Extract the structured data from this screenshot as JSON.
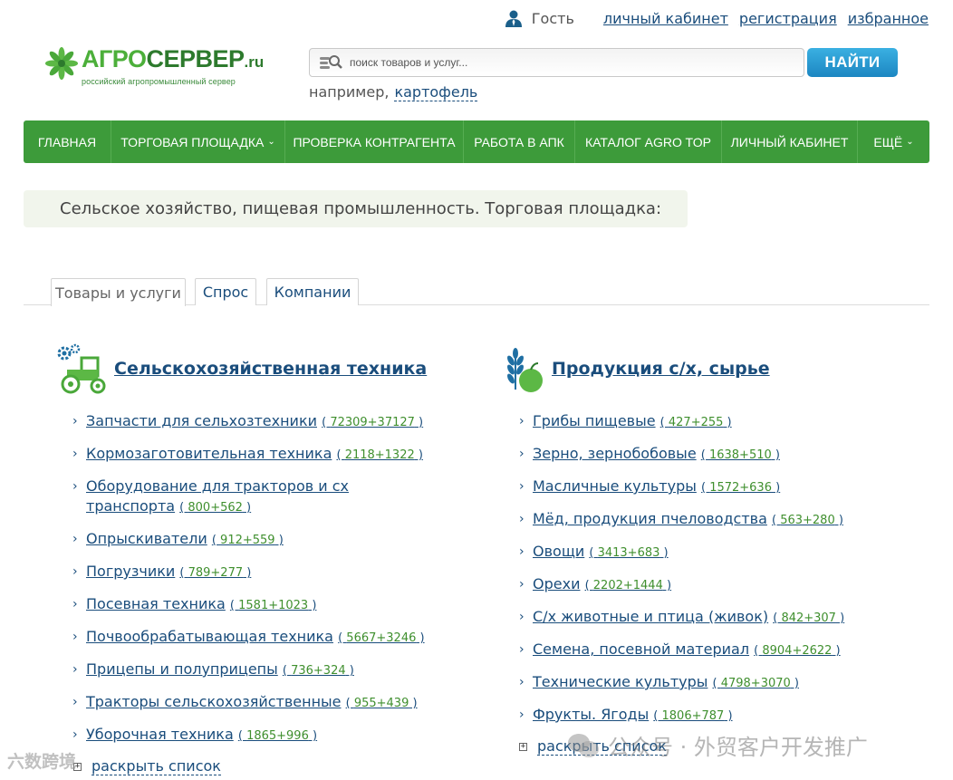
{
  "topbar": {
    "guest_label": "Гость",
    "links": [
      "личный кабинет",
      "регистрация",
      "избранное"
    ]
  },
  "logo": {
    "name_part1": "АГРО",
    "name_part2": "СЕРВЕР",
    "name_suffix": ".ru",
    "tagline": "российский агропромышленный сервер"
  },
  "search": {
    "placeholder": "поиск товаров и услуг...",
    "button_label": "НАЙТИ",
    "example_prefix": "например,",
    "example_link": "картофель"
  },
  "nav": {
    "items": [
      {
        "label": "ГЛАВНАЯ",
        "caret": ""
      },
      {
        "label": "ТОРГОВАЯ ПЛОЩАДКА",
        "caret": "⌄"
      },
      {
        "label": "ПРОВЕРКА КОНТРАГЕНТА",
        "caret": ""
      },
      {
        "label": "РАБОТА В АПК",
        "caret": ""
      },
      {
        "label": "КАТАЛОГ AGRO TOP",
        "caret": ""
      },
      {
        "label": "ЛИЧНЫЙ КАБИНЕТ",
        "caret": ""
      },
      {
        "label": "ЕЩЁ",
        "caret": "⌄"
      }
    ]
  },
  "page": {
    "heading": "Сельское хозяйство, пищевая промышленность. Торговая площадка:"
  },
  "tabs": [
    "Товары и услуги",
    "Спрос",
    "Компании"
  ],
  "categories": [
    {
      "title": "Сельскохозяйственная техника",
      "icon": "tractor-icon",
      "items": [
        {
          "label": "Запчасти для сельхозтехники",
          "count": "72309+37127"
        },
        {
          "label": "Кормозаготовительная техника",
          "count": "2118+1322"
        },
        {
          "label": "Оборудование для тракторов и сх",
          "label2": "транспорта",
          "count": "800+562"
        },
        {
          "label": "Опрыскиватели",
          "count": "912+559"
        },
        {
          "label": "Погрузчики",
          "count": "789+277"
        },
        {
          "label": "Посевная техника",
          "count": "1581+1023"
        },
        {
          "label": "Почвообрабатывающая техника",
          "count": "5667+3246"
        },
        {
          "label": "Прицепы и полуприцепы",
          "count": "736+324"
        },
        {
          "label": "Тракторы сельскохозяйственные",
          "count": "955+439"
        },
        {
          "label": "Уборочная техника",
          "count": "1865+996"
        }
      ],
      "expand_label": "раскрыть список"
    },
    {
      "title": "Продукция с/х, сырье",
      "icon": "wheat-apple-icon",
      "items": [
        {
          "label": "Грибы пищевые",
          "count": "427+255"
        },
        {
          "label": "Зерно, зернобобовые",
          "count": "1638+510"
        },
        {
          "label": "Масличные культуры",
          "count": "1572+636"
        },
        {
          "label": "Мёд, продукция пчеловодства",
          "count": "563+280"
        },
        {
          "label": "Овощи",
          "count": "3413+683"
        },
        {
          "label": "Орехи",
          "count": "2202+1444"
        },
        {
          "label": "С/х животные и птица (живок)",
          "count": "842+307"
        },
        {
          "label": "Семена, посевной материал",
          "count": "8904+2622"
        },
        {
          "label": "Технические культуры",
          "count": "4798+3070"
        },
        {
          "label": "Фрукты. Ягоды",
          "count": "1806+787"
        }
      ],
      "expand_label": "раскрыть список"
    }
  ],
  "watermarks": {
    "bottom_right": "公众号 · 外贸客户开发推广",
    "bottom_left": "六数跨境"
  },
  "colors": {
    "nav_green": "#3d9b3a",
    "link_blue": "#1a4d7c",
    "count_green": "#3f8f2e",
    "button_blue": "#1c86c2"
  }
}
